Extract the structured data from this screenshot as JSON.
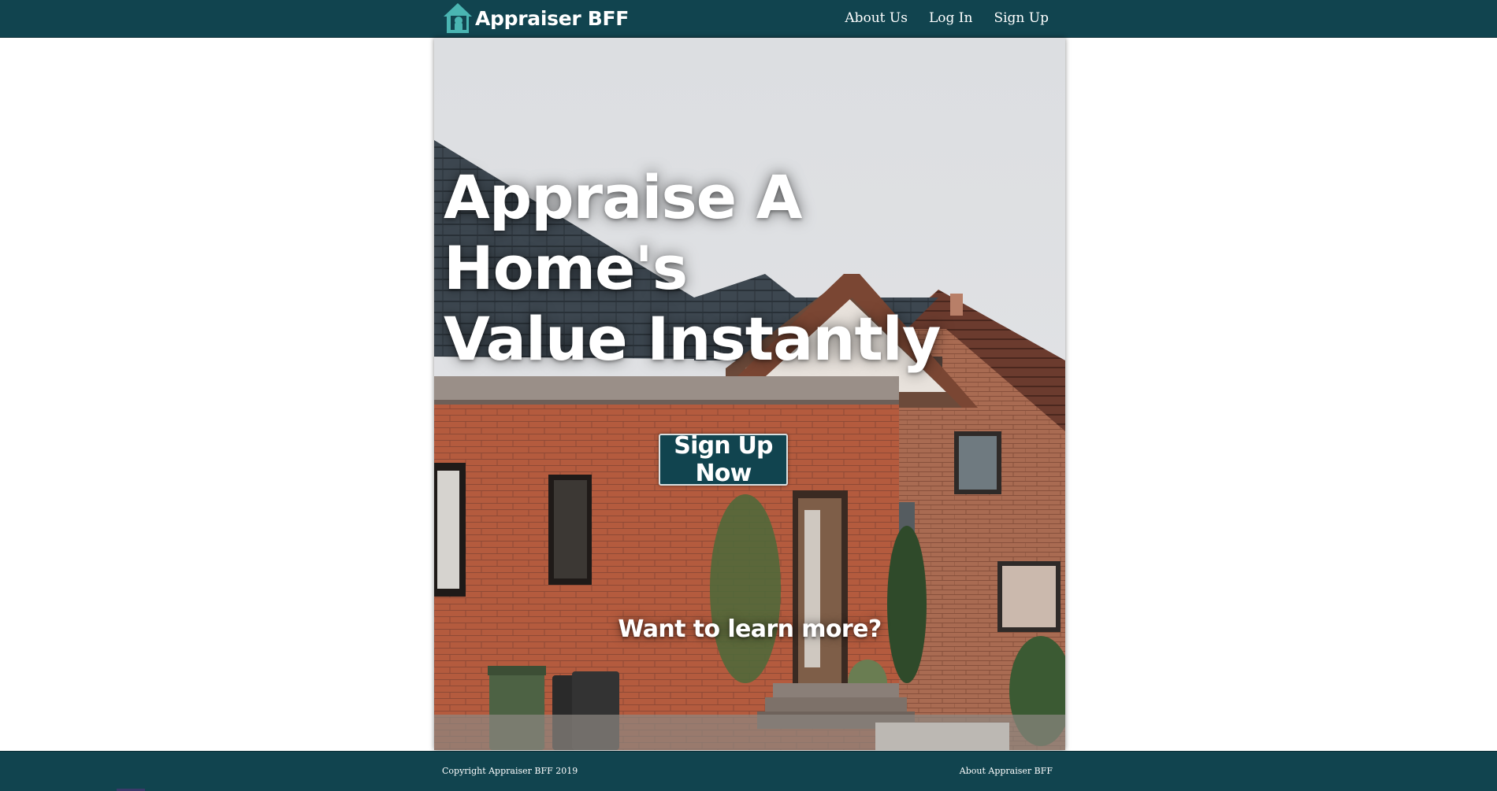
{
  "nav": {
    "brand": "Appraiser BFF",
    "brand_icon": "house-icon",
    "links": [
      "About Us",
      "Log In",
      "Sign Up"
    ]
  },
  "hero": {
    "headline_line1": "Appraise A Home's",
    "headline_line2": "Value Instantly",
    "cta_label": "Sign Up Now",
    "learn_more": "Want to learn more?",
    "background": "brick-house-photo"
  },
  "footer": {
    "copyright": "Copyright Appraiser BFF 2019",
    "about_link": "About Appraiser BFF"
  },
  "colors": {
    "primary": "#11444f",
    "accent_icon": "#4ab5b2",
    "text": "#ffffff",
    "brick": "#b35a3d"
  }
}
